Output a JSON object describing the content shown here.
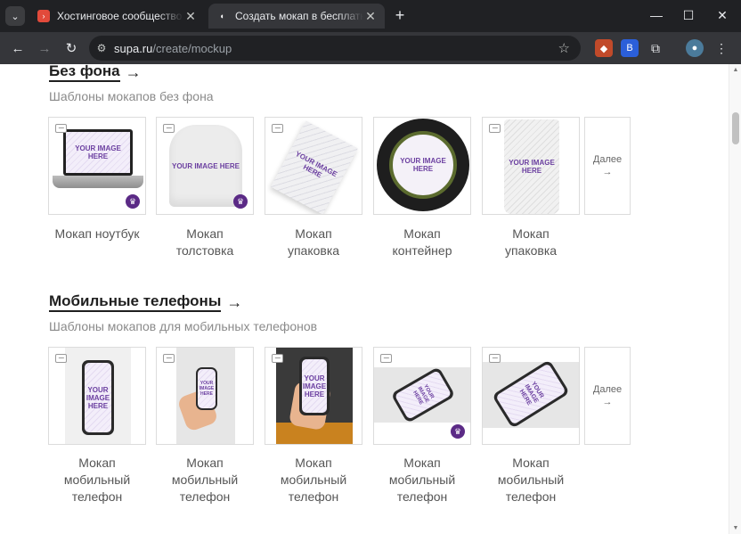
{
  "browser": {
    "tabs": [
      {
        "title": "Хостинговое сообщество «Tim",
        "active": false
      },
      {
        "title": "Создать мокап в бесплатном о",
        "active": true
      }
    ],
    "url_host": "supa.ru",
    "url_path": "/create/mockup"
  },
  "sections": [
    {
      "title": "Без фона",
      "subtitle": "Шаблоны мокапов без фона",
      "more_label": "Далее",
      "cards": [
        {
          "caption": "Мокап ноутбук",
          "premium": true
        },
        {
          "caption": "Мокап толстовка",
          "premium": true
        },
        {
          "caption": "Мокап упаковка",
          "premium": false
        },
        {
          "caption": "Мокап контейнер",
          "premium": false
        },
        {
          "caption": "Мокап упаковка",
          "premium": false
        }
      ]
    },
    {
      "title": "Мобильные телефоны",
      "subtitle": "Шаблоны мокапов для мобильных телефонов",
      "more_label": "Далее",
      "cards": [
        {
          "caption": "Мокап мобильный телефон",
          "premium": false
        },
        {
          "caption": "Мокап мобильный телефон",
          "premium": false
        },
        {
          "caption": "Мокап мобильный телефон",
          "premium": false
        },
        {
          "caption": "Мокап мобильный телефон",
          "premium": true
        },
        {
          "caption": "Мокап мобильный телефон",
          "premium": false
        }
      ]
    }
  ],
  "placeholder_text": "YOUR IMAGE HERE",
  "colors": {
    "accent": "#5b2a86",
    "placeholder_text": "#6b3fa0"
  }
}
